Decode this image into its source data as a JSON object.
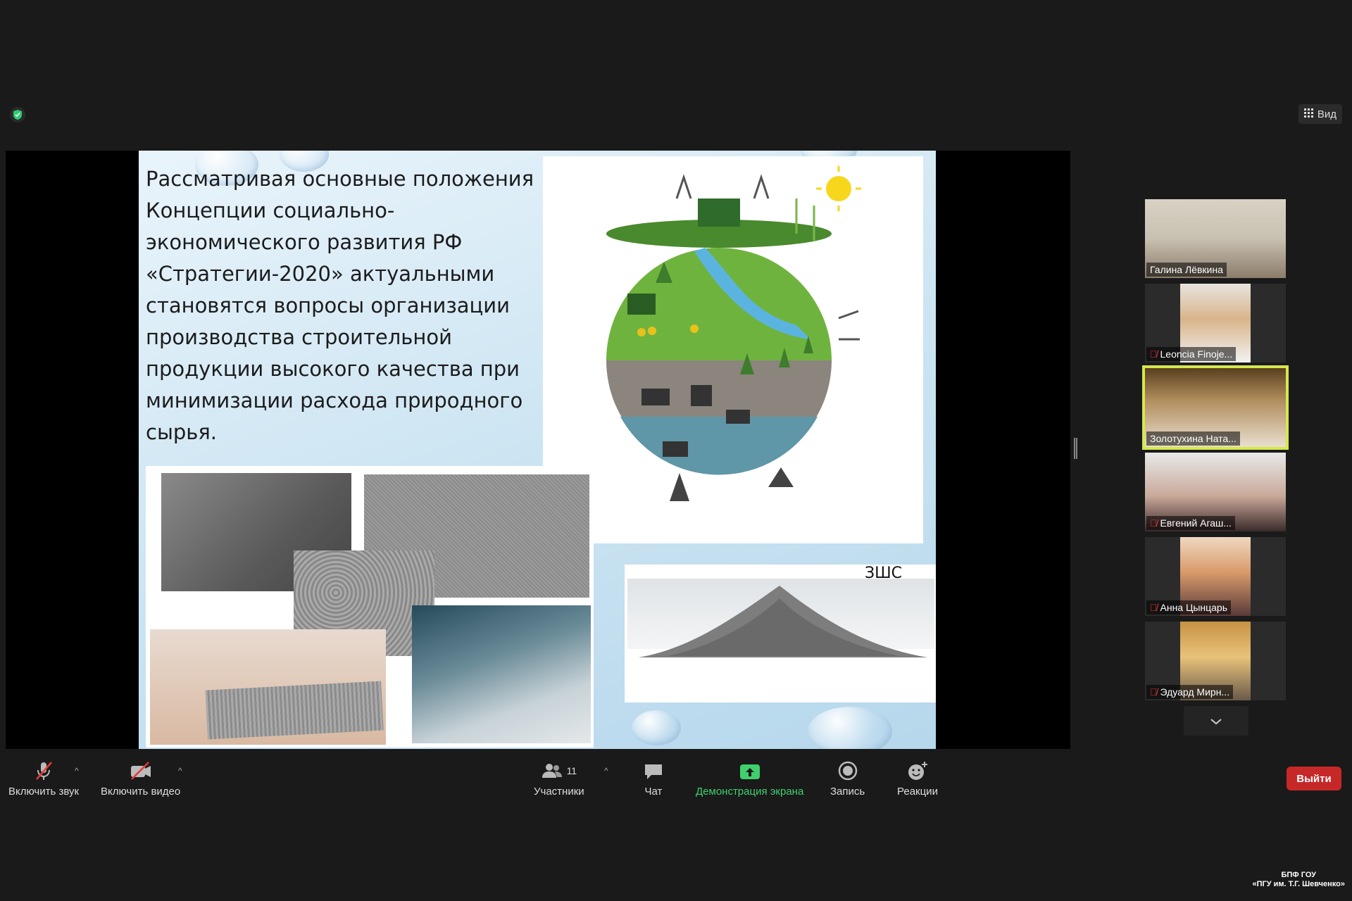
{
  "top": {
    "view_label": "Вид"
  },
  "slide": {
    "text": "Рассматривая основные положения Концепции социально-экономического развития РФ «Стратегии-2020» актуальными становятся вопросы организации производства строительной продукции высокого качества при минимизации расхода природного сырья.",
    "pile_label": "ЗШС"
  },
  "participants": [
    {
      "name": "Галина Лёвкина",
      "muted": false
    },
    {
      "name": "Leoncia Finoje...",
      "muted": true
    },
    {
      "name": "Золотухина Ната...",
      "muted": false,
      "active": true
    },
    {
      "name": "Евгений Агаш...",
      "muted": true
    },
    {
      "name": "Анна Цынцарь",
      "muted": true
    },
    {
      "name": "Эдуард Мирн...",
      "muted": true
    }
  ],
  "toolbar": {
    "unmute": "Включить звук",
    "start_video": "Включить видео",
    "participants": "Участники",
    "participants_count": "11",
    "chat": "Чат",
    "share_screen": "Демонстрация экрана",
    "record": "Запись",
    "reactions": "Реакции",
    "leave": "Выйти"
  },
  "watermark": {
    "line1": "БПФ ГОУ",
    "line2": "«ПГУ им. Т.Г. Шевченко»"
  },
  "colors": {
    "accent_green": "#3fd06d",
    "leave_red": "#c62828",
    "active_outline": "#d5e84a"
  }
}
